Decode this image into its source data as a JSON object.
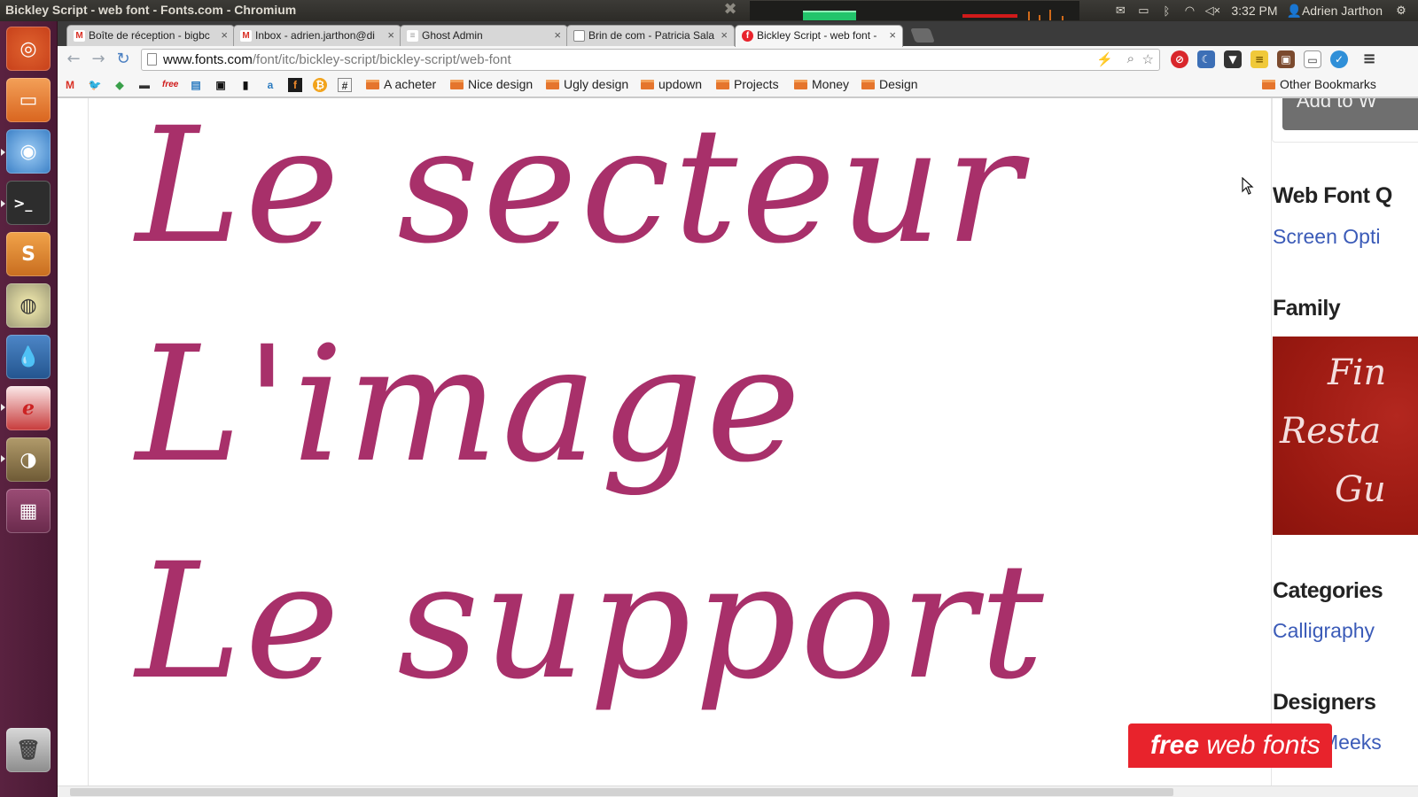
{
  "window": {
    "title": "Bickley Script - web font - Fonts.com - Chromium"
  },
  "panel": {
    "time": "3:32 PM",
    "user": "Adrien Jarthon"
  },
  "tabs": [
    {
      "label": "Boîte de réception - bigbc",
      "favicon": "gmail-icon",
      "favicon_color": "#d93025"
    },
    {
      "label": "Inbox - adrien.jarthon@di",
      "favicon": "gmail-icon",
      "favicon_color": "#d93025"
    },
    {
      "label": "Ghost Admin",
      "favicon": "ghost-icon",
      "favicon_color": "#9a9a9a"
    },
    {
      "label": "Brin de com - Patricia Sala",
      "favicon": "page-icon",
      "favicon_color": "#888888"
    },
    {
      "label": "Bickley Script - web font -",
      "favicon": "fonts-com-icon",
      "favicon_color": "#e8232c"
    }
  ],
  "address": {
    "host": "www.fonts.com",
    "path": "/font/itc/bickley-script/bickley-script/web-font"
  },
  "bookmarks": {
    "folders": [
      "A acheter",
      "Nice design",
      "Ugly design",
      "updown",
      "Projects",
      "Money",
      "Design"
    ],
    "other": "Other Bookmarks"
  },
  "specimen": {
    "lines": [
      "Le secteur",
      "L'image",
      "Le support"
    ],
    "color": "#a8306a"
  },
  "sidebar": {
    "add_button": "Add to W",
    "quick_heading": "Web Font Q",
    "quick_link": "Screen Opti",
    "family_heading": "Family",
    "family_image_text": [
      "Fin",
      "Resta",
      "Gu"
    ],
    "categories_heading": "Categories",
    "category_link": "Calligraphy",
    "designers_heading": "Designers",
    "designer_link": "Meeks"
  },
  "banner": {
    "bold": "free",
    "rest": " web fonts"
  }
}
